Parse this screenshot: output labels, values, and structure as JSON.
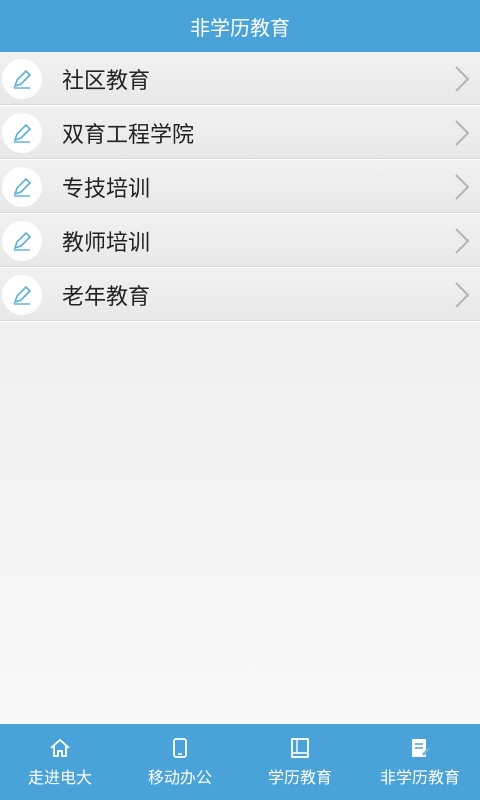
{
  "header": {
    "title": "非学历教育"
  },
  "list": {
    "items": [
      {
        "label": "社区教育",
        "icon": "pencil-icon"
      },
      {
        "label": "双育工程学院",
        "icon": "pencil-icon"
      },
      {
        "label": "专技培训",
        "icon": "pencil-icon"
      },
      {
        "label": "教师培训",
        "icon": "pencil-icon"
      },
      {
        "label": "老年教育",
        "icon": "pencil-icon"
      }
    ]
  },
  "tabbar": {
    "tabs": [
      {
        "label": "走进电大",
        "icon": "home-icon"
      },
      {
        "label": "移动办公",
        "icon": "phone-icon"
      },
      {
        "label": "学历教育",
        "icon": "book-icon"
      },
      {
        "label": "非学历教育",
        "icon": "notepad-pen-icon"
      }
    ]
  },
  "colors": {
    "header_bg": "#4aa3d8",
    "tabbar_bg": "#4aa3d8",
    "icon_accent": "#5bb0d8",
    "chevron": "#b5b5b5"
  }
}
